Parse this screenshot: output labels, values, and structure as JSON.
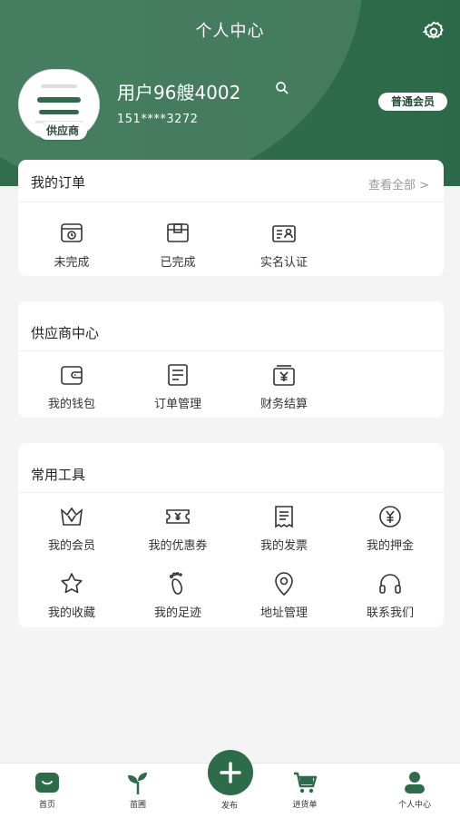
{
  "header": {
    "title": "个人中心",
    "role_badge": "供应商",
    "username": "用户96艘4002",
    "phone": "151****3272",
    "member_badge": "普通会员",
    "accent_color": "#2e6b4b"
  },
  "orders": {
    "title": "我的订单",
    "view_all": "查看全部 >",
    "items": [
      {
        "label": "未完成",
        "icon": "pending-order-icon"
      },
      {
        "label": "已完成",
        "icon": "completed-order-icon"
      },
      {
        "label": "实名认证",
        "icon": "id-card-icon"
      }
    ]
  },
  "supplier": {
    "title": "供应商中心",
    "items": [
      {
        "label": "我的钱包",
        "icon": "wallet-icon"
      },
      {
        "label": "订单管理",
        "icon": "order-management-icon"
      },
      {
        "label": "财务结算",
        "icon": "finance-icon"
      }
    ]
  },
  "tools": {
    "title": "常用工具",
    "items": [
      {
        "label": "我的会员",
        "icon": "crown-icon"
      },
      {
        "label": "我的优惠券",
        "icon": "coupon-icon"
      },
      {
        "label": "我的发票",
        "icon": "invoice-icon"
      },
      {
        "label": "我的押金",
        "icon": "deposit-icon"
      },
      {
        "label": "我的收藏",
        "icon": "star-icon"
      },
      {
        "label": "我的足迹",
        "icon": "footprint-icon"
      },
      {
        "label": "地址管理",
        "icon": "location-icon"
      },
      {
        "label": "联系我们",
        "icon": "headset-icon"
      }
    ]
  },
  "tabbar": {
    "items": [
      {
        "label": "首页",
        "icon": "home-icon"
      },
      {
        "label": "苗圃",
        "icon": "seedling-icon"
      },
      {
        "label": "发布",
        "icon": "plus-icon"
      },
      {
        "label": "进货单",
        "icon": "cart-icon"
      },
      {
        "label": "个人中心",
        "icon": "user-icon"
      }
    ]
  }
}
